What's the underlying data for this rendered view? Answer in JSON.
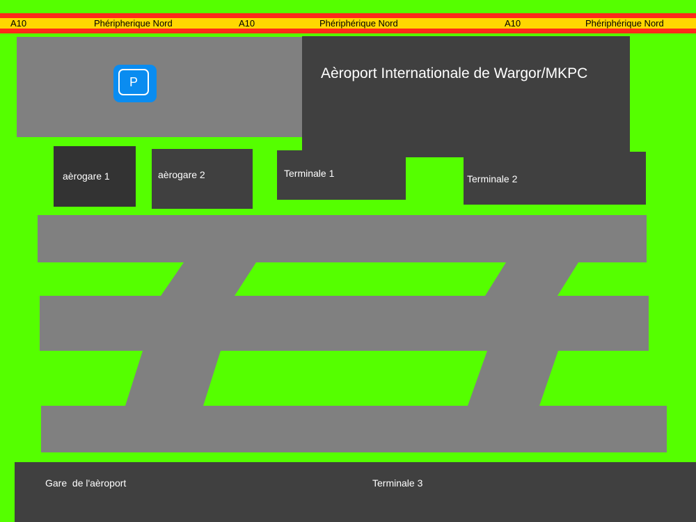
{
  "ring_road": {
    "labels": [
      "A10",
      "Phéripherique Nord",
      "A10",
      "Phériphérique Nord",
      "A10",
      "Phériphérique Nord"
    ]
  },
  "airport": {
    "name": "Aèroport Internationale de Wargor/MKPC"
  },
  "parking": {
    "icon": "parking-icon",
    "letter": "P",
    "color": "#0a8cf0"
  },
  "buildings": {
    "aerogare_1": "aèrogare 1",
    "aerogare_2": "aèrogare 2",
    "terminale_1": "Terminale 1",
    "terminale_2": "Terminale 2",
    "gare": "Gare  de l'aèroport",
    "terminale_3": "Terminale 3"
  },
  "colors": {
    "grass": "#55ff00",
    "road_edge": "#ff2a1a",
    "road_center": "#ffd700",
    "building": "#404040",
    "tarmac": "#808080"
  }
}
